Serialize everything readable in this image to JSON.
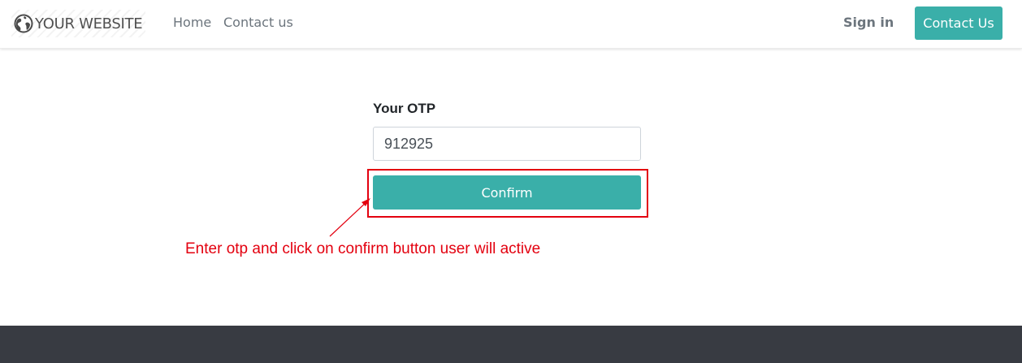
{
  "header": {
    "brand": "YOUR WEBSITE",
    "brand_icon": "globe-icon",
    "nav": [
      {
        "label": "Home"
      },
      {
        "label": "Contact us"
      }
    ],
    "sign_in": "Sign in",
    "contact_button": "Contact Us"
  },
  "form": {
    "otp_label": "Your OTP",
    "otp_value": "912925",
    "confirm_label": "Confirm"
  },
  "annotation": {
    "text": "Enter otp and click on confirm button user will active",
    "color": "#e3000f"
  },
  "colors": {
    "accent": "#3aafa9",
    "footer": "#383b42"
  }
}
